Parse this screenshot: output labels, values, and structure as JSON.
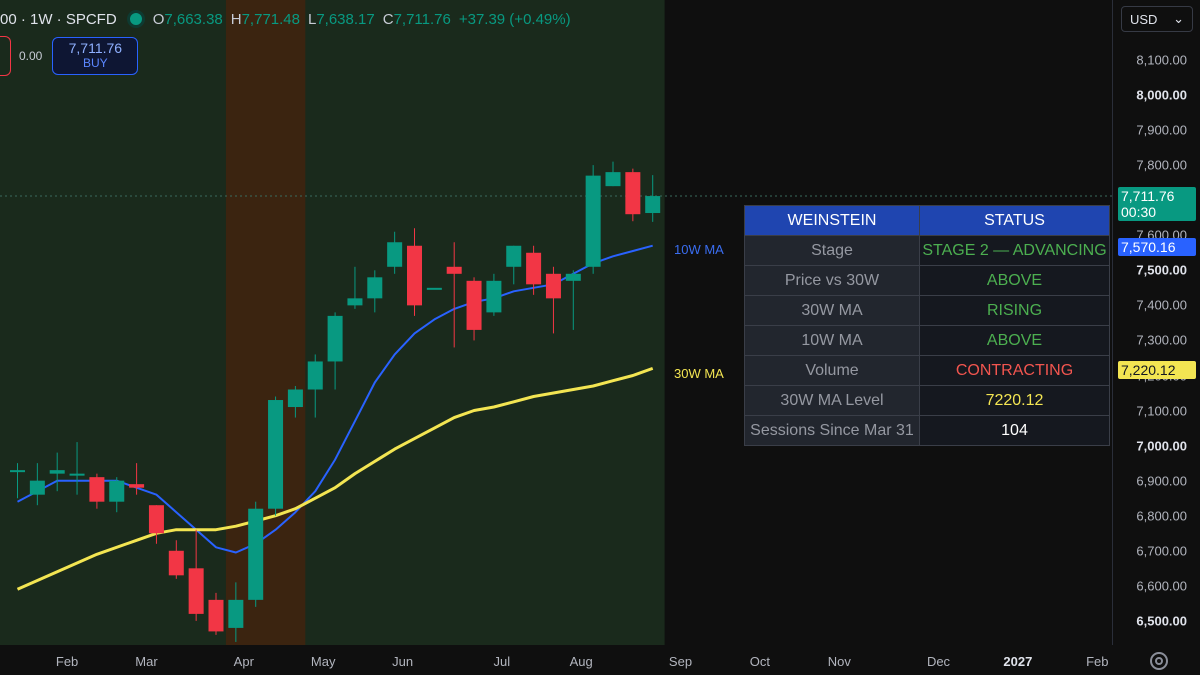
{
  "header": {
    "symbol": "00 · 1W · SPCFD",
    "o_key": "O",
    "o_val": "7,663.38",
    "h_key": "H",
    "h_val": "7,771.48",
    "l_key": "L",
    "l_val": "7,638.17",
    "c_key": "C",
    "c_val": "7,711.76",
    "change": "+37.39 (+0.49%)"
  },
  "order": {
    "spread": "0.00",
    "buy_price": "7,711.76",
    "buy_label": "BUY"
  },
  "labels": {
    "ma10": "10W MA",
    "ma30": "30W MA"
  },
  "table": {
    "headers": [
      "WEINSTEIN",
      "STATUS"
    ],
    "rows": [
      {
        "label": "Stage",
        "value": "STAGE 2 — ADVANCING",
        "color": "green"
      },
      {
        "label": "Price vs 30W",
        "value": "ABOVE",
        "color": "green"
      },
      {
        "label": "30W MA",
        "value": "RISING",
        "color": "green"
      },
      {
        "label": "10W MA",
        "value": "ABOVE",
        "color": "green"
      },
      {
        "label": "Volume",
        "value": "CONTRACTING",
        "color": "red"
      },
      {
        "label": "30W MA Level",
        "value": "7220.12",
        "color": "yellow"
      },
      {
        "label": "Sessions Since Mar 31",
        "value": "104",
        "color": "white"
      }
    ]
  },
  "price_axis": {
    "currency": "USD",
    "ticks": [
      {
        "price": 8100,
        "label": "8,100.00",
        "bold": false
      },
      {
        "price": 8000,
        "label": "8,000.00",
        "bold": true
      },
      {
        "price": 7900,
        "label": "7,900.00",
        "bold": false
      },
      {
        "price": 7800,
        "label": "7,800.00",
        "bold": false
      },
      {
        "price": 7600,
        "label": "7,600.00",
        "bold": false
      },
      {
        "price": 7500,
        "label": "7,500.00",
        "bold": true
      },
      {
        "price": 7400,
        "label": "7,400.00",
        "bold": false
      },
      {
        "price": 7300,
        "label": "7,300.00",
        "bold": false
      },
      {
        "price": 7200,
        "label": "7,200.00",
        "bold": false
      },
      {
        "price": 7100,
        "label": "7,100.00",
        "bold": false
      },
      {
        "price": 7000,
        "label": "7,000.00",
        "bold": true
      },
      {
        "price": 6900,
        "label": "6,900.00",
        "bold": false
      },
      {
        "price": 6800,
        "label": "6,800.00",
        "bold": false
      },
      {
        "price": 6700,
        "label": "6,700.00",
        "bold": false
      },
      {
        "price": 6600,
        "label": "6,600.00",
        "bold": false
      },
      {
        "price": 6500,
        "label": "6,500.00",
        "bold": true
      }
    ],
    "last_price": "7,711.76",
    "countdown": "00:30",
    "ma10_value": "7,570.16",
    "ma30_value": "7,220.12"
  },
  "time_axis": [
    {
      "week": 2.5,
      "label": "Feb",
      "bold": false
    },
    {
      "week": 6.5,
      "label": "Mar",
      "bold": false
    },
    {
      "week": 11.4,
      "label": "Apr",
      "bold": false
    },
    {
      "week": 15.4,
      "label": "May",
      "bold": false
    },
    {
      "week": 19.4,
      "label": "Jun",
      "bold": false
    },
    {
      "week": 24.4,
      "label": "Jul",
      "bold": false
    },
    {
      "week": 28.4,
      "label": "Aug",
      "bold": false
    },
    {
      "week": 33.4,
      "label": "Sep",
      "bold": false
    },
    {
      "week": 37.4,
      "label": "Oct",
      "bold": false
    },
    {
      "week": 41.4,
      "label": "Nov",
      "bold": false
    },
    {
      "week": 46.4,
      "label": "Dec",
      "bold": false
    },
    {
      "week": 50.4,
      "label": "2027",
      "bold": true
    },
    {
      "week": 54.4,
      "label": "Feb",
      "bold": false
    }
  ],
  "colors": {
    "up": "#089981",
    "down": "#f23645",
    "ma10": "#2962ff",
    "ma30": "#f3e552",
    "stage_bg": "#1a2a1c",
    "highlight_bg": "#3b2410",
    "green": "#4caf50",
    "red": "#f2554f",
    "yellow": "#f3e552",
    "white": "#ffffff"
  },
  "chart_data": {
    "type": "candlestick",
    "timeframe": "1W",
    "ylim": [
      6450,
      8200
    ],
    "candles": [
      {
        "w": 0,
        "o": 6930,
        "h": 6950,
        "l": 6850,
        "c": 6930
      },
      {
        "w": 1,
        "o": 6860,
        "h": 6950,
        "l": 6830,
        "c": 6900
      },
      {
        "w": 2,
        "o": 6920,
        "h": 6980,
        "l": 6870,
        "c": 6930
      },
      {
        "w": 3,
        "o": 6920,
        "h": 7010,
        "l": 6860,
        "c": 6920
      },
      {
        "w": 4,
        "o": 6910,
        "h": 6920,
        "l": 6820,
        "c": 6840
      },
      {
        "w": 5,
        "o": 6840,
        "h": 6910,
        "l": 6810,
        "c": 6900
      },
      {
        "w": 6,
        "o": 6890,
        "h": 6950,
        "l": 6860,
        "c": 6880
      },
      {
        "w": 7,
        "o": 6830,
        "h": 6830,
        "l": 6720,
        "c": 6750
      },
      {
        "w": 8,
        "o": 6700,
        "h": 6730,
        "l": 6620,
        "c": 6630
      },
      {
        "w": 9,
        "o": 6650,
        "h": 6760,
        "l": 6500,
        "c": 6520
      },
      {
        "w": 10,
        "o": 6560,
        "h": 6580,
        "l": 6460,
        "c": 6470
      },
      {
        "w": 11,
        "o": 6480,
        "h": 6610,
        "l": 6440,
        "c": 6560
      },
      {
        "w": 12,
        "o": 6560,
        "h": 6840,
        "l": 6540,
        "c": 6820
      },
      {
        "w": 13,
        "o": 6820,
        "h": 7140,
        "l": 6800,
        "c": 7130
      },
      {
        "w": 14,
        "o": 7110,
        "h": 7170,
        "l": 7080,
        "c": 7160
      },
      {
        "w": 15,
        "o": 7160,
        "h": 7260,
        "l": 7080,
        "c": 7240
      },
      {
        "w": 16,
        "o": 7240,
        "h": 7380,
        "l": 7160,
        "c": 7370
      },
      {
        "w": 17,
        "o": 7400,
        "h": 7510,
        "l": 7390,
        "c": 7420
      },
      {
        "w": 18,
        "o": 7420,
        "h": 7500,
        "l": 7380,
        "c": 7480
      },
      {
        "w": 19,
        "o": 7510,
        "h": 7610,
        "l": 7490,
        "c": 7580
      },
      {
        "w": 20,
        "o": 7570,
        "h": 7620,
        "l": 7370,
        "c": 7400
      },
      {
        "w": 21,
        "o": 7450,
        "h": 7450,
        "l": 7450,
        "c": 7450
      },
      {
        "w": 22,
        "o": 7510,
        "h": 7580,
        "l": 7280,
        "c": 7490
      },
      {
        "w": 23,
        "o": 7470,
        "h": 7480,
        "l": 7300,
        "c": 7330
      },
      {
        "w": 24,
        "o": 7380,
        "h": 7490,
        "l": 7370,
        "c": 7470
      },
      {
        "w": 25,
        "o": 7510,
        "h": 7570,
        "l": 7460,
        "c": 7570
      },
      {
        "w": 26,
        "o": 7550,
        "h": 7570,
        "l": 7430,
        "c": 7460
      },
      {
        "w": 27,
        "o": 7490,
        "h": 7510,
        "l": 7320,
        "c": 7420
      },
      {
        "w": 28,
        "o": 7470,
        "h": 7500,
        "l": 7330,
        "c": 7490
      },
      {
        "w": 29,
        "o": 7510,
        "h": 7800,
        "l": 7490,
        "c": 7770
      },
      {
        "w": 30,
        "o": 7740,
        "h": 7810,
        "l": 7740,
        "c": 7780
      },
      {
        "w": 31,
        "o": 7780,
        "h": 7790,
        "l": 7640,
        "c": 7660
      },
      {
        "w": 32,
        "o": 7663.38,
        "h": 7771.48,
        "l": 7638.17,
        "c": 7711.76
      }
    ],
    "series": [
      {
        "name": "10W MA",
        "points": [
          [
            0,
            6840
          ],
          [
            2,
            6900
          ],
          [
            5,
            6900
          ],
          [
            7,
            6860
          ],
          [
            8,
            6810
          ],
          [
            9,
            6760
          ],
          [
            10,
            6710
          ],
          [
            11,
            6695
          ],
          [
            12,
            6720
          ],
          [
            13,
            6760
          ],
          [
            14,
            6810
          ],
          [
            15,
            6870
          ],
          [
            16,
            6960
          ],
          [
            17,
            7070
          ],
          [
            18,
            7180
          ],
          [
            19,
            7260
          ],
          [
            20,
            7320
          ],
          [
            21,
            7360
          ],
          [
            22,
            7390
          ],
          [
            23,
            7410
          ],
          [
            24,
            7420
          ],
          [
            25,
            7440
          ],
          [
            26,
            7450
          ],
          [
            27,
            7460
          ],
          [
            28,
            7490
          ],
          [
            29,
            7520
          ],
          [
            30,
            7540
          ],
          [
            31,
            7555
          ],
          [
            32,
            7570.16
          ]
        ]
      },
      {
        "name": "30W MA",
        "points": [
          [
            0,
            6590
          ],
          [
            2,
            6640
          ],
          [
            4,
            6690
          ],
          [
            6,
            6730
          ],
          [
            7,
            6750
          ],
          [
            8,
            6760
          ],
          [
            9,
            6760
          ],
          [
            10,
            6760
          ],
          [
            11,
            6770
          ],
          [
            12,
            6785
          ],
          [
            13,
            6800
          ],
          [
            14,
            6820
          ],
          [
            15,
            6850
          ],
          [
            16,
            6880
          ],
          [
            17,
            6920
          ],
          [
            18,
            6955
          ],
          [
            19,
            6990
          ],
          [
            20,
            7020
          ],
          [
            21,
            7050
          ],
          [
            22,
            7080
          ],
          [
            23,
            7100
          ],
          [
            24,
            7110
          ],
          [
            25,
            7125
          ],
          [
            26,
            7140
          ],
          [
            27,
            7150
          ],
          [
            28,
            7160
          ],
          [
            29,
            7170
          ],
          [
            30,
            7185
          ],
          [
            31,
            7200
          ],
          [
            32,
            7220.12
          ]
        ]
      }
    ],
    "highlight_weeks": [
      10.5,
      14.5
    ],
    "stage_weeks_end": 32.6
  }
}
